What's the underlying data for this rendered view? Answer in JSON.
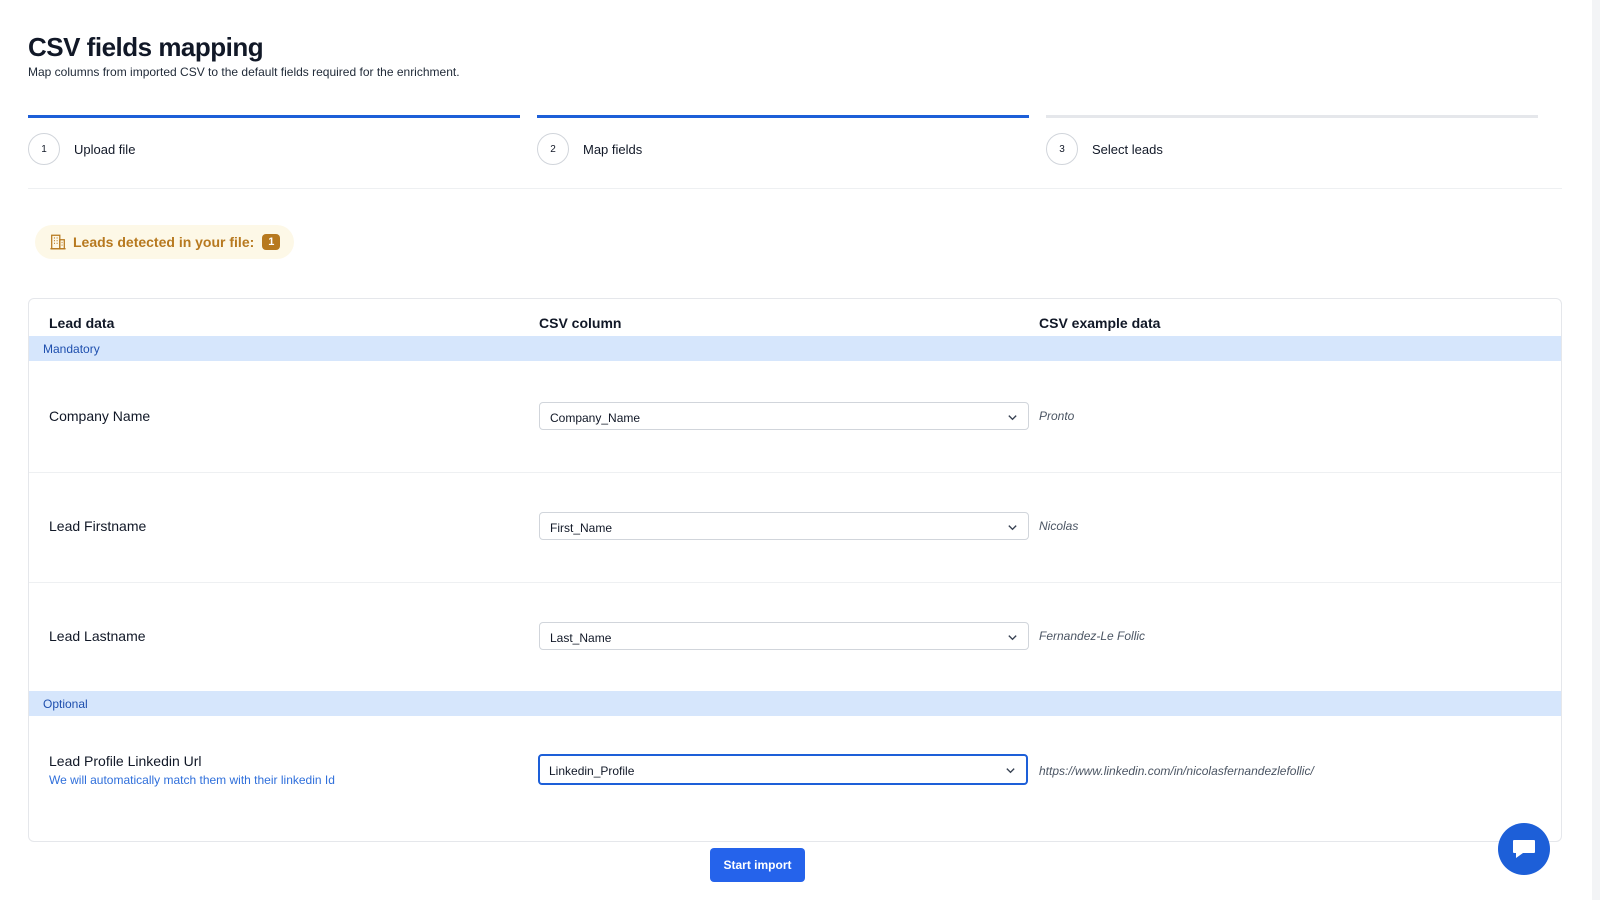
{
  "header": {
    "title": "CSV fields mapping",
    "subtitle": "Map columns from imported CSV to the default fields required for the enrichment."
  },
  "steps": [
    {
      "number": "1",
      "label": "Upload file",
      "status": "done"
    },
    {
      "number": "2",
      "label": "Map fields",
      "status": "active"
    },
    {
      "number": "3",
      "label": "Select leads",
      "status": "todo"
    }
  ],
  "leads_badge": {
    "label": "Leads detected in your file:",
    "count": "1",
    "icon": "building-icon"
  },
  "table": {
    "columns": [
      "Lead data",
      "CSV column",
      "CSV example data"
    ],
    "sections": [
      {
        "label": "Mandatory",
        "rows": [
          {
            "field": "Company Name",
            "csv_column": "Company_Name",
            "example": "Pronto"
          },
          {
            "field": "Lead Firstname",
            "csv_column": "First_Name",
            "example": "Nicolas"
          },
          {
            "field": "Lead Lastname",
            "csv_column": "Last_Name",
            "example": "Fernandez-Le Follic"
          }
        ]
      },
      {
        "label": "Optional",
        "rows": [
          {
            "field": "Lead Profile Linkedin Url",
            "help": "We will automatically match them with their linkedin Id",
            "csv_column": "Linkedin_Profile",
            "example": "https://www.linkedin.com/in/nicolasfernandezlefollic/"
          }
        ]
      }
    ]
  },
  "actions": {
    "start_import": "Start import"
  },
  "colors": {
    "primary": "#2563eb",
    "accent_bar": "#1d5fd8",
    "section_bg": "#d6e6fc",
    "badge_text": "#b7791f",
    "badge_bg": "#fdf8e7"
  }
}
